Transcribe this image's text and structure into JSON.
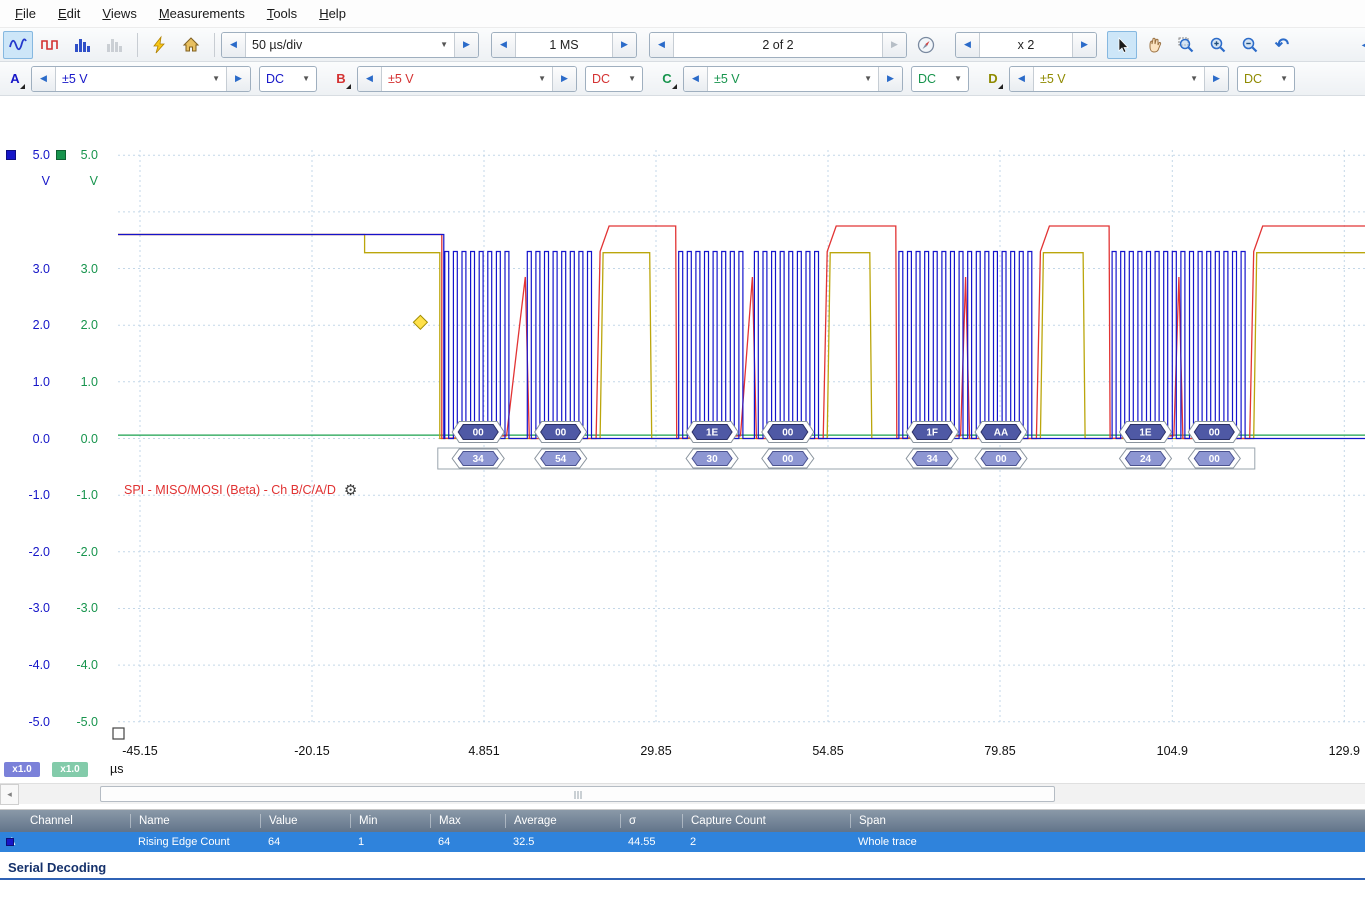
{
  "menu": {
    "items": [
      {
        "label": "File"
      },
      {
        "label": "Edit"
      },
      {
        "label": "Views"
      },
      {
        "label": "Measurements"
      },
      {
        "label": "Tools"
      },
      {
        "label": "Help"
      }
    ]
  },
  "icons": {
    "left_arrow": "◀",
    "right_arrow": "▶",
    "dropdown": "▼",
    "gear": "⚙",
    "scroll_left": "◂",
    "undo": "↶"
  },
  "toolbar": {
    "timebase_value": "50 µs/div",
    "samples_value": "1 MS",
    "buffer_value": "2 of 2",
    "zoom_value": "x 2"
  },
  "channels": [
    {
      "id": "A",
      "range": "±5 V",
      "coupling": "DC",
      "color": "#1616c8"
    },
    {
      "id": "B",
      "range": "±5 V",
      "coupling": "DC",
      "color": "#d43232"
    },
    {
      "id": "C",
      "range": "±5 V",
      "coupling": "DC",
      "color": "#17944d"
    },
    {
      "id": "D",
      "range": "±5 V",
      "coupling": "DC",
      "color": "#8f8a00"
    }
  ],
  "chart_data": {
    "type": "line",
    "x_axis": {
      "unit": "µs",
      "ticks_us": [
        -45.15,
        -20.15,
        4.851,
        29.85,
        54.85,
        79.85,
        104.9,
        129.9
      ],
      "tick_labels": [
        "-45.15",
        "-20.15",
        "4.851",
        "29.85",
        "54.85",
        "79.85",
        "104.9",
        "129.9"
      ]
    },
    "y_axes": [
      {
        "name": "channel-A-axis",
        "color": "#1616c8",
        "unit": "V",
        "min": -5,
        "max": 5,
        "tick_labels": [
          "5.0",
          "3.0",
          "2.0",
          "1.0",
          "0.0",
          "-1.0",
          "-2.0",
          "-3.0",
          "-4.0",
          "-5.0"
        ],
        "zoom_badge": "x1.0",
        "zoom_badge_color": "#7b81d9"
      },
      {
        "name": "channel-C-axis",
        "color": "#17944d",
        "unit": "V",
        "min": -5,
        "max": 5,
        "tick_labels": [
          "5.0",
          "3.0",
          "2.0",
          "1.0",
          "0.0",
          "-1.0",
          "-2.0",
          "-3.0",
          "-4.0",
          "-5.0"
        ],
        "zoom_badge": "x1.0",
        "zoom_badge_color": "#83cbaa"
      }
    ],
    "grid": true,
    "trigger": {
      "time_us": -4.4,
      "level_v": 2.05
    },
    "series": [
      {
        "name": "channel-A-spi-clock",
        "color": "#1414cc",
        "idle_level_v": 3.6,
        "burst_high_v": 3.3,
        "burst_low_v": 0
      },
      {
        "name": "channel-B-analog",
        "color": "#e23434",
        "idle_level_v": 3.6,
        "plateau_v": 3.75,
        "ramp_peak_v": 2.85
      },
      {
        "name": "channel-C-flat",
        "color": "#18a04e",
        "level_v": 0.06
      },
      {
        "name": "channel-D-chip-select",
        "color": "#bba60c",
        "idle_level_v": 3.6,
        "step_v": 3.28
      }
    ],
    "spi_decode": {
      "label": "SPI - MISO/MOSI (Beta) - Ch B/C/A/D",
      "byte_duration_us": 10,
      "clocks_per_byte": 8,
      "bytes": [
        {
          "t_us": -1,
          "miso": "00",
          "mosi": "34"
        },
        {
          "t_us": 11,
          "miso": "00",
          "mosi": "54"
        },
        {
          "t_us": 33,
          "miso": "1E",
          "mosi": "30"
        },
        {
          "t_us": 44,
          "miso": "00",
          "mosi": "00"
        },
        {
          "t_us": 65,
          "miso": "1F",
          "mosi": "34"
        },
        {
          "t_us": 75,
          "miso": "AA",
          "mosi": "00"
        },
        {
          "t_us": 96,
          "miso": "1E",
          "mosi": "24"
        },
        {
          "t_us": 106,
          "miso": "00",
          "mosi": "00"
        }
      ],
      "badge_colors": {
        "miso_fill": "#4f59a5",
        "mosi_fill": "#8d96d2"
      }
    }
  },
  "measurements": {
    "columns": [
      "Channel",
      "Name",
      "Value",
      "Min",
      "Max",
      "Average",
      "σ",
      "Capture Count",
      "Span"
    ],
    "rows": [
      {
        "channel": "A",
        "channel_color": "#1616c8",
        "name": "Rising Edge Count",
        "value": "64",
        "min": "1",
        "max": "64",
        "average": "32.5",
        "sigma": "44.55",
        "capture_count": "2",
        "span": "Whole trace"
      }
    ]
  },
  "serial_decoding": {
    "title": "Serial Decoding"
  }
}
